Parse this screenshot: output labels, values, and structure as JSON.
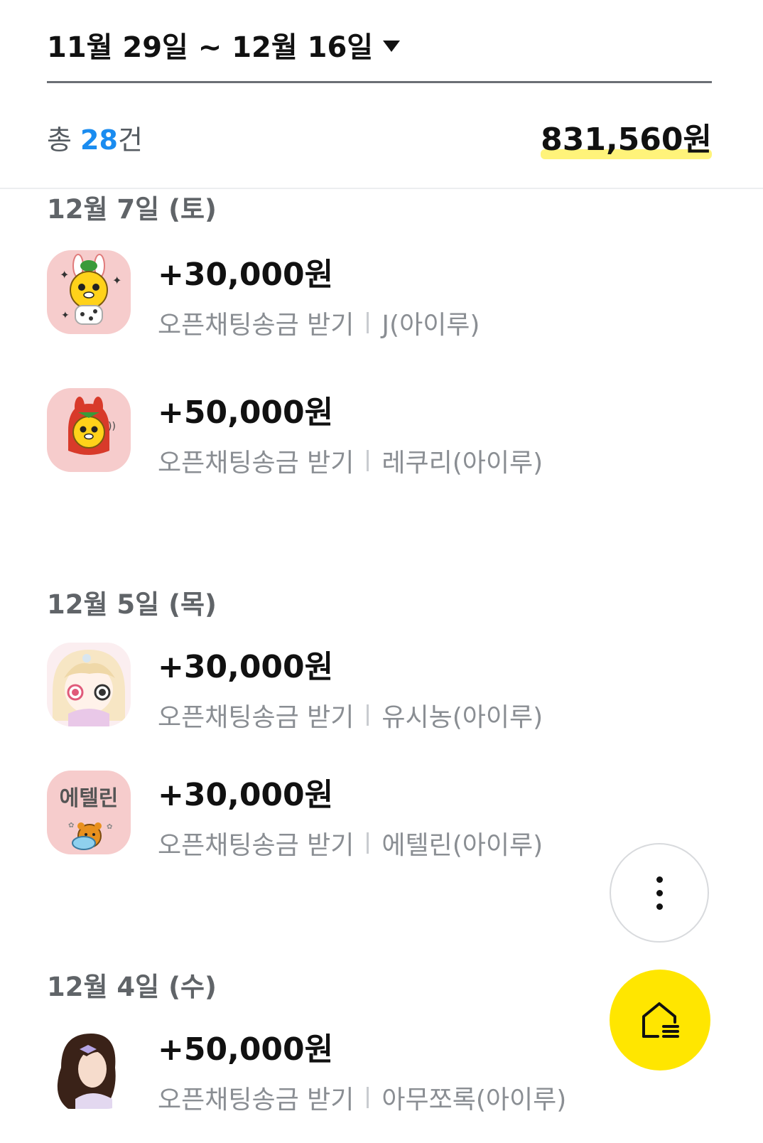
{
  "header": {
    "date_range": "11월 29일 ~ 12월 16일"
  },
  "summary": {
    "count_prefix": "총 ",
    "count": "28",
    "count_suffix": "건",
    "total": "831,560원"
  },
  "groups": [
    {
      "date": "12월 7일 (토)",
      "items": [
        {
          "amount": "+30,000원",
          "type": "오픈채팅송금 받기",
          "sender": "J(아이루)",
          "avatar": "bunny-character-avatar"
        },
        {
          "amount": "+50,000원",
          "type": "오픈채팅송금 받기",
          "sender": "레쿠리(아이루)",
          "avatar": "red-hood-character-avatar"
        }
      ]
    },
    {
      "date": "12월 5일 (목)",
      "items": [
        {
          "amount": "+30,000원",
          "type": "오픈채팅송금 받기",
          "sender": "유시농(아이루)",
          "avatar": "anime-girl-avatar"
        },
        {
          "amount": "+30,000원",
          "type": "오픈채팅송금 받기",
          "sender": "에텔린(아이루)",
          "avatar": "bear-character-avatar",
          "avatar_text": "에텔린"
        }
      ]
    },
    {
      "date": "12월 4일 (수)",
      "items": [
        {
          "amount": "+50,000원",
          "type": "오픈채팅송금 받기",
          "sender": "아무쪼록(아이루)",
          "avatar": "girl-ribbon-avatar"
        }
      ]
    }
  ],
  "icons": {
    "dropdown": "caret-down-icon",
    "more": "more-vertical-icon",
    "home": "home-icon"
  },
  "colors": {
    "accent_blue": "#1a8cf0",
    "highlight_yellow": "#fff37a",
    "home_button": "#ffe600",
    "avatar_bg": "#f6cccc"
  }
}
